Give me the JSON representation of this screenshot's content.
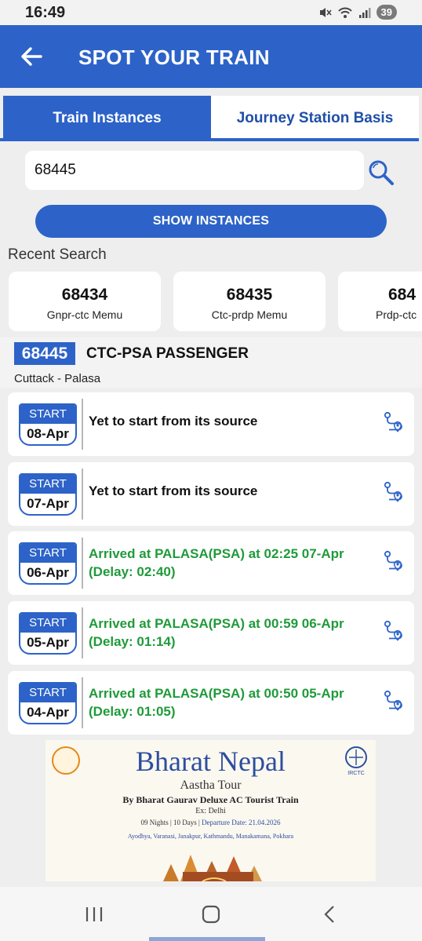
{
  "status_bar": {
    "time": "16:49",
    "battery": "39"
  },
  "app_bar": {
    "title": "SPOT YOUR TRAIN"
  },
  "tabs": [
    {
      "label": "Train Instances",
      "active": true
    },
    {
      "label": "Journey Station Basis",
      "active": false
    }
  ],
  "search": {
    "value": "68445",
    "placeholder": ""
  },
  "show_button": {
    "label": "SHOW INSTANCES"
  },
  "recent_search": {
    "label": "Recent Search",
    "items": [
      {
        "number": "68434",
        "name": "Gnpr-ctc Memu"
      },
      {
        "number": "68435",
        "name": "Ctc-prdp Memu"
      },
      {
        "number": "684",
        "name": "Prdp-ctc"
      }
    ]
  },
  "train": {
    "number": "68445",
    "name": "CTC-PSA PASSENGER",
    "route": "Cuttack - Palasa"
  },
  "instances": [
    {
      "start_label": "START",
      "date": "08-Apr",
      "status_line1": "Yet to start from its source",
      "status_line2": "",
      "arrived": false
    },
    {
      "start_label": "START",
      "date": "07-Apr",
      "status_line1": "Yet to start from its source",
      "status_line2": "",
      "arrived": false
    },
    {
      "start_label": "START",
      "date": "06-Apr",
      "status_line1": "Arrived at PALASA(PSA) at 02:25 07-Apr",
      "status_line2": "(Delay: 02:40)",
      "arrived": true
    },
    {
      "start_label": "START",
      "date": "05-Apr",
      "status_line1": "Arrived at PALASA(PSA) at 00:59 06-Apr",
      "status_line2": "(Delay: 01:14)",
      "arrived": true
    },
    {
      "start_label": "START",
      "date": "04-Apr",
      "status_line1": "Arrived at PALASA(PSA) at 00:50 05-Apr",
      "status_line2": "(Delay: 01:05)",
      "arrived": true
    }
  ],
  "banner": {
    "title": "Bharat Nepal",
    "subtitle": "Aastha Tour",
    "line1": "By Bharat Gaurav Deluxe AC Tourist Train",
    "line2": "Ex: Delhi",
    "line3_left": "09 Nights | 10 Days | ",
    "line3_right": "Departure Date: 21.04.2026",
    "line4": "Ayodhya, Varanasi, Janakpur, Kathmandu, Manakamana, Pokhara",
    "logo_right_text": "IRCTC"
  },
  "icons": {
    "back": "arrow-left-icon",
    "search": "magnifier-icon",
    "route": "route-map-icon",
    "nav_recents": "recents-icon",
    "nav_home": "home-icon",
    "nav_back": "back-chevron-icon"
  },
  "colors": {
    "primary": "#2d63c8",
    "arrived": "#1f9a3a",
    "background": "#eeeeee"
  }
}
